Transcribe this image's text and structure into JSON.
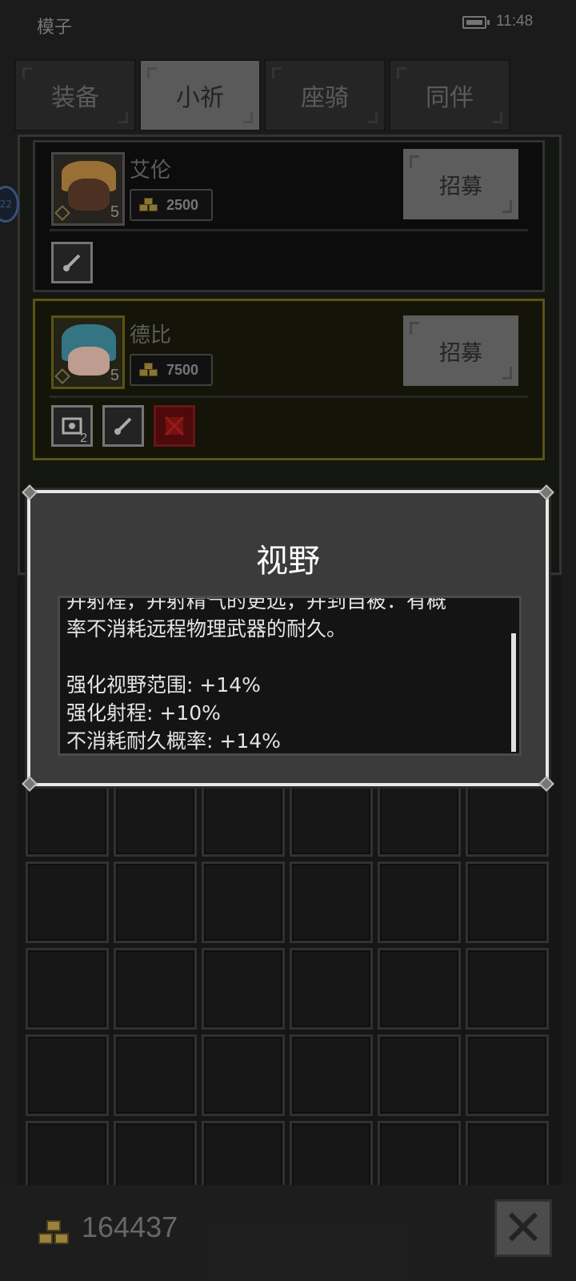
{
  "status_bar": {
    "app_name": "模子",
    "time": "11:48"
  },
  "tabs": [
    {
      "label": "装备",
      "active": false
    },
    {
      "label": "小祈",
      "active": true
    },
    {
      "label": "座骑",
      "active": false
    },
    {
      "label": "同伴",
      "active": false
    }
  ],
  "side_badge": "22",
  "companions": [
    {
      "name": "艾伦",
      "level": "5",
      "cost": "2500",
      "recruit_label": "招募",
      "hair_color": "#b3843f",
      "skills": [
        "staff-icon"
      ]
    },
    {
      "name": "德比",
      "level": "5",
      "cost": "7500",
      "recruit_label": "招募",
      "hair_color": "#3f8a9a",
      "skills": [
        "eye-scroll-icon",
        "staff-icon",
        "red-rune-icon"
      ],
      "skill_count": "2"
    }
  ],
  "dialog": {
    "title": "视野",
    "lines": [
      "并射程，并射精气的更远，并到自被：有概",
      "率不消耗远程物理武器的耐久。",
      "",
      "强化视野范围: +14%",
      "强化射程: +10%",
      "不消耗耐久概率: +14%"
    ]
  },
  "footer": {
    "gold_total": "164437"
  },
  "colors": {
    "panel": "#3b3b3b",
    "border": "#e8e8e8",
    "gold": "#b49a45",
    "selected": "#6a6318"
  }
}
